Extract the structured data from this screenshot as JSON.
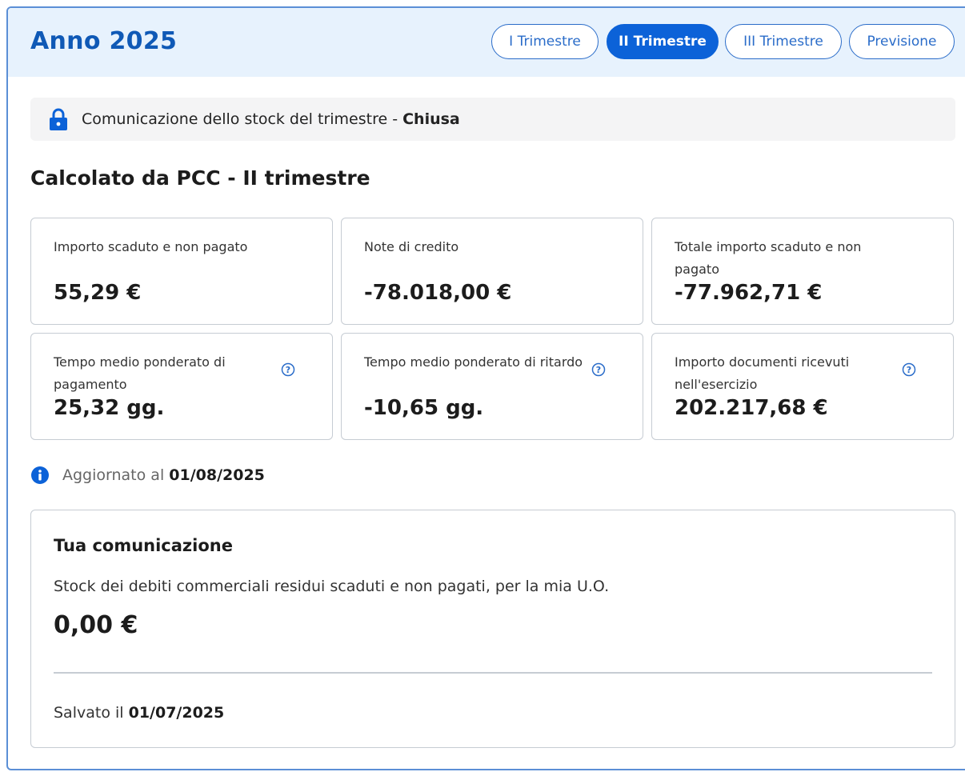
{
  "header": {
    "title": "Anno 2025",
    "tabs": [
      {
        "label": "I Trimestre",
        "active": false
      },
      {
        "label": "II Trimestre",
        "active": true
      },
      {
        "label": "III Trimestre",
        "active": false
      },
      {
        "label": "Previsione",
        "active": false
      }
    ]
  },
  "notice": {
    "icon": "lock-icon",
    "text": "Comunicazione dello stock del trimestre - ",
    "status": "Chiusa"
  },
  "section": {
    "title": "Calcolato da PCC - II trimestre"
  },
  "cards": [
    {
      "label": "Importo scaduto e non pagato",
      "value": "55,29 €",
      "help": false
    },
    {
      "label": "Note di credito",
      "value": "-78.018,00 €",
      "help": false
    },
    {
      "label": "Totale importo scaduto e non pagato",
      "value": "-77.962,71 €",
      "help": false
    },
    {
      "label": "Tempo medio ponderato di pagamento",
      "value": "25,32 gg.",
      "help": true
    },
    {
      "label": "Tempo medio ponderato di ritardo",
      "value": "-10,65 gg.",
      "help": true
    },
    {
      "label": "Importo documenti ricevuti nell'esercizio",
      "value": "202.217,68 €",
      "help": true
    }
  ],
  "updated": {
    "label": "Aggiornato al ",
    "date": "01/08/2025"
  },
  "communication": {
    "title": "Tua comunicazione",
    "description": "Stock dei debiti commerciali residui scaduti e non pagati, per la mia U.O.",
    "amount": "0,00 €",
    "saved_label": "Salvato il ",
    "saved_date": "01/07/2025"
  },
  "colors": {
    "accent": "#0c62d8",
    "title": "#0f59b6",
    "header_bg": "#e7f2fd"
  }
}
